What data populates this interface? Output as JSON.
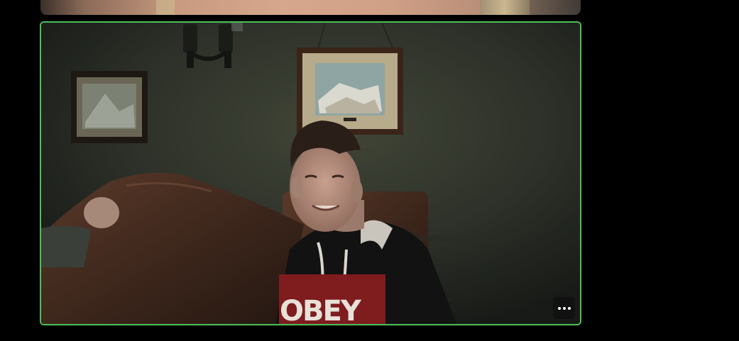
{
  "tiles": {
    "top_tile": {
      "partial": true
    },
    "active_tile": {
      "highlight_color": "#4cc05a",
      "more_options_icon": "more-horizontal-icon",
      "hoodie_print": "OBEY"
    }
  }
}
